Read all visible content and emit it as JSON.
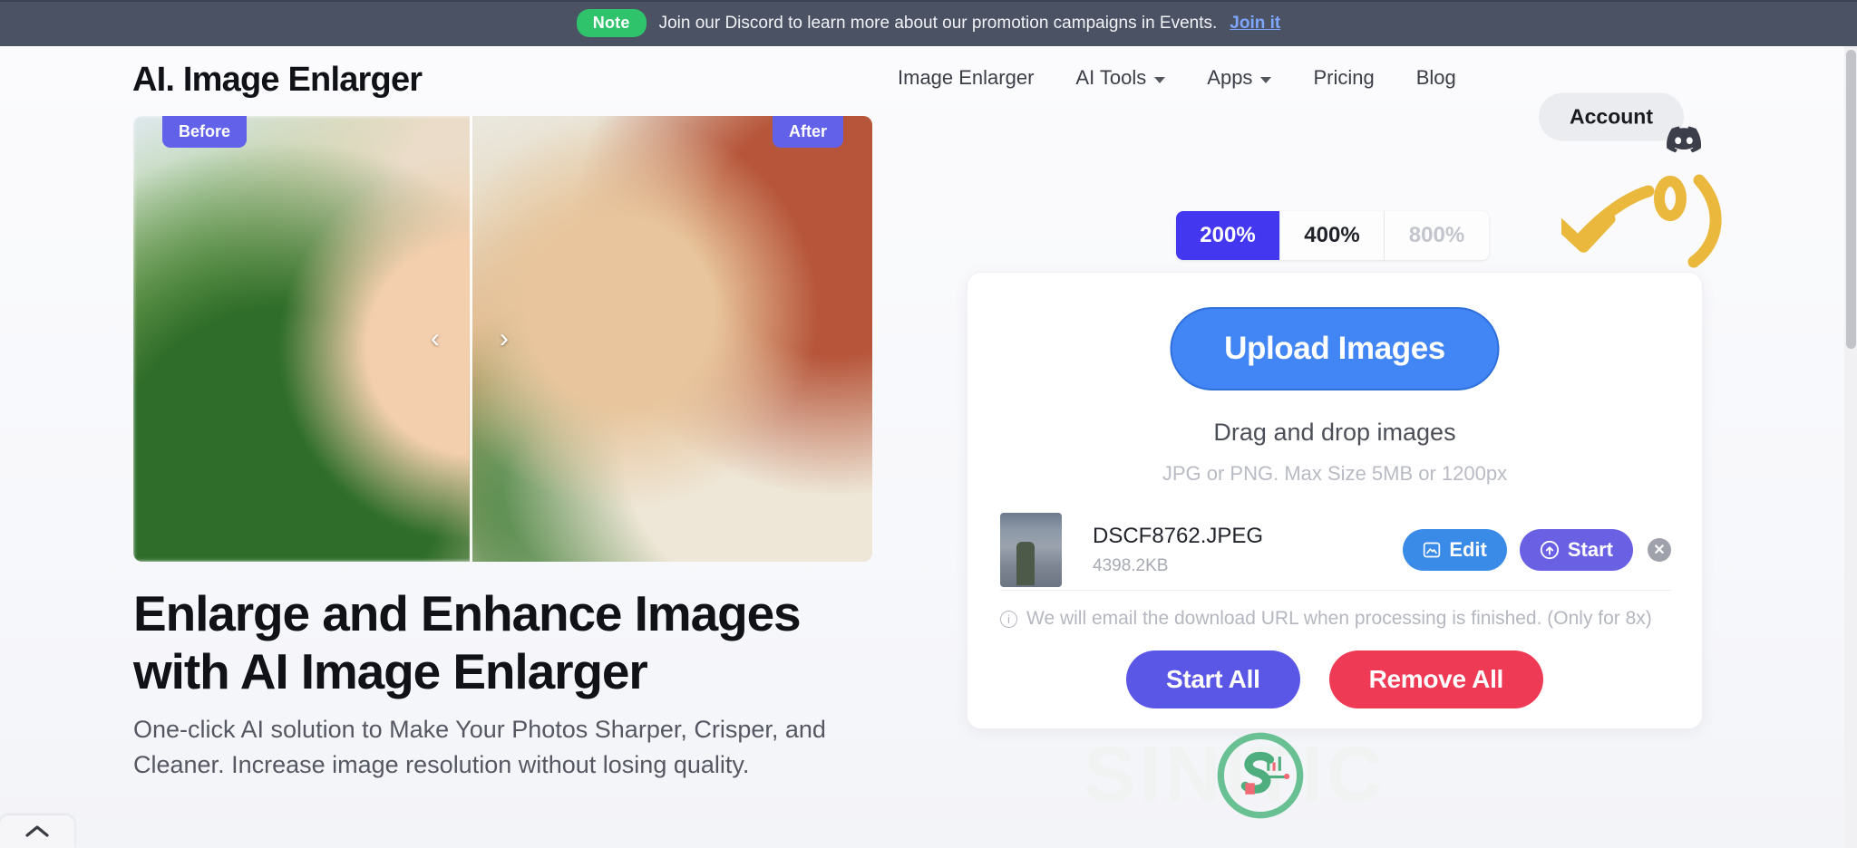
{
  "notice": {
    "badge": "Note",
    "text": "Join our Discord to learn more about our promotion campaigns in Events.",
    "link": "Join it"
  },
  "nav": {
    "brand": "AI. Image Enlarger",
    "links": [
      {
        "label": "Image Enlarger",
        "has_caret": false
      },
      {
        "label": "AI Tools",
        "has_caret": true
      },
      {
        "label": "Apps",
        "has_caret": true
      },
      {
        "label": "Pricing",
        "has_caret": false
      },
      {
        "label": "Blog",
        "has_caret": false
      }
    ],
    "account_label": "Account",
    "discord_icon": "discord-icon"
  },
  "hero": {
    "compare": {
      "before_tag": "Before",
      "after_tag": "After",
      "prev_arrow": "‹",
      "next_arrow": "›"
    },
    "title_line1": "Enlarge and Enhance Images",
    "title_line2": "with AI Image Enlarger",
    "subtitle_line1": "One-click AI solution to Make Your Photos Sharper, Crisper, and",
    "subtitle_line2": "Cleaner. Increase image resolution without losing quality."
  },
  "upload_panel": {
    "zoom_options": [
      {
        "label": "200%",
        "state": "active"
      },
      {
        "label": "400%",
        "state": "normal"
      },
      {
        "label": "800%",
        "state": "disabled"
      }
    ],
    "upload_button": "Upload Images",
    "drag_text": "Drag and drop images",
    "limit_text": "JPG or PNG. Max Size 5MB or 1200px",
    "files": [
      {
        "name": "DSCF8762.JPEG",
        "size": "4398.2KB",
        "edit_label": "Edit",
        "start_label": "Start",
        "remove_label": "✕"
      }
    ],
    "email_note": "We will email the download URL when processing is finished. (Only for 8x)",
    "start_all_label": "Start All",
    "remove_all_label": "Remove All"
  },
  "decor": {
    "watermark_text": "SINITIC",
    "arrow_annotation": "curved-arrow-annotation",
    "collapse_icon": "chevron-up-icon"
  },
  "colors": {
    "accent_blue": "#4285f4",
    "active_toggle": "#4338f0",
    "start_all": "#5a56e6",
    "remove_all": "#ef3a55",
    "notice_bar": "#4b5264",
    "badge_green": "#2fc36b",
    "tag_purple": "#6161ea",
    "annotation_yellow": "#eab83c"
  }
}
